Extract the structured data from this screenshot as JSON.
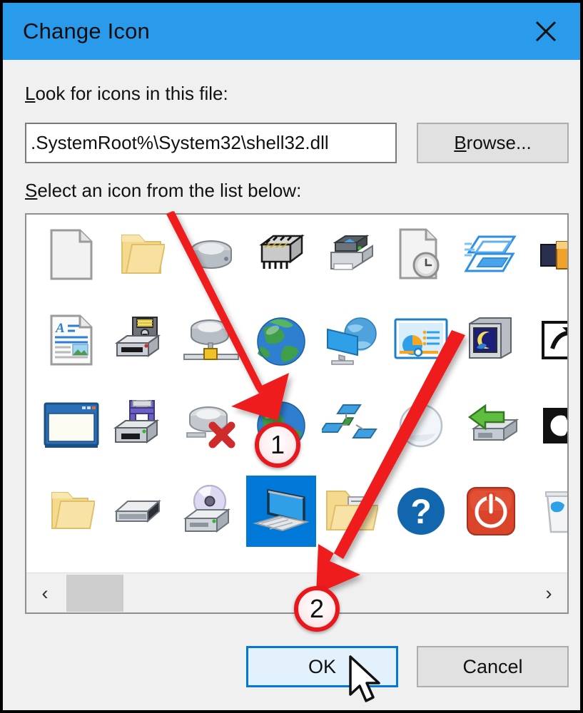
{
  "window": {
    "title": "Change Icon",
    "close_icon": "close-icon",
    "titlebar_color": "#2a9bea"
  },
  "form": {
    "lookfor_label": "Look for icons in this file:",
    "lookfor_label_mnemonic": "L",
    "path_value": "%SystemRoot%\\System32\\shell32.dll",
    "path_display": ".SystemRoot%\\System32\\shell32.dll",
    "path_placeholder": "%SystemRoot%\\System32\\shell32.dll",
    "browse_label": "Browse...",
    "browse_label_mnemonic": "B",
    "select_label": "Select an icon from the list below:",
    "select_label_mnemonic": "S"
  },
  "icon_grid": {
    "columns": 8,
    "rows": 4,
    "selected_index": 27,
    "selection_color": "#0078d7",
    "cells": [
      {
        "name": "blank-document-icon",
        "row": 0,
        "col": 0
      },
      {
        "name": "folder-open-icon",
        "row": 0,
        "col": 1
      },
      {
        "name": "hard-drive-icon",
        "row": 0,
        "col": 2
      },
      {
        "name": "memory-chip-icon",
        "row": 0,
        "col": 3
      },
      {
        "name": "printer-icon",
        "row": 0,
        "col": 4
      },
      {
        "name": "recent-document-icon",
        "row": 0,
        "col": 5
      },
      {
        "name": "stacked-windows-icon",
        "row": 0,
        "col": 6
      },
      {
        "name": "battery-icon",
        "row": 0,
        "col": 7
      },
      {
        "name": "text-document-icon",
        "row": 1,
        "col": 0
      },
      {
        "name": "floppy-drive-icon",
        "row": 1,
        "col": 1
      },
      {
        "name": "network-drive-icon",
        "row": 1,
        "col": 2
      },
      {
        "name": "globe-green-icon",
        "row": 1,
        "col": 3
      },
      {
        "name": "network-monitor-icon",
        "row": 1,
        "col": 4
      },
      {
        "name": "presentation-icon",
        "row": 1,
        "col": 5
      },
      {
        "name": "night-monitor-icon",
        "row": 1,
        "col": 6
      },
      {
        "name": "shortcut-arrow-icon",
        "row": 1,
        "col": 7
      },
      {
        "name": "window-icon",
        "row": 2,
        "col": 0
      },
      {
        "name": "mapped-drive-icon",
        "row": 2,
        "col": 1
      },
      {
        "name": "disconnected-drive-icon",
        "row": 2,
        "col": 2
      },
      {
        "name": "globe-internet-icon",
        "row": 2,
        "col": 3
      },
      {
        "name": "network-nodes-icon",
        "row": 2,
        "col": 4
      },
      {
        "name": "sphere-icon",
        "row": 2,
        "col": 5
      },
      {
        "name": "restore-drive-icon",
        "row": 2,
        "col": 6
      },
      {
        "name": "clock-black-icon",
        "row": 2,
        "col": 7
      },
      {
        "name": "folder-icon",
        "row": 3,
        "col": 0
      },
      {
        "name": "drive-icon",
        "row": 3,
        "col": 1
      },
      {
        "name": "cd-drive-icon",
        "row": 3,
        "col": 2
      },
      {
        "name": "this-pc-icon",
        "row": 3,
        "col": 3
      },
      {
        "name": "folder-documents-icon",
        "row": 3,
        "col": 4
      },
      {
        "name": "help-question-icon",
        "row": 3,
        "col": 5
      },
      {
        "name": "shutdown-power-icon",
        "row": 3,
        "col": 6
      },
      {
        "name": "recycle-bin-icon",
        "row": 3,
        "col": 7
      }
    ]
  },
  "scrollbar": {
    "left_arrow": "‹",
    "right_arrow": "›",
    "thumb_position_pct": 7
  },
  "buttons": {
    "ok_label": "OK",
    "cancel_label": "Cancel"
  },
  "annotations": {
    "items": [
      {
        "label": "1",
        "target": "globe-internet-icon"
      },
      {
        "label": "2",
        "target": "ok-button"
      }
    ],
    "arrow_color": "#ee1c1c"
  }
}
